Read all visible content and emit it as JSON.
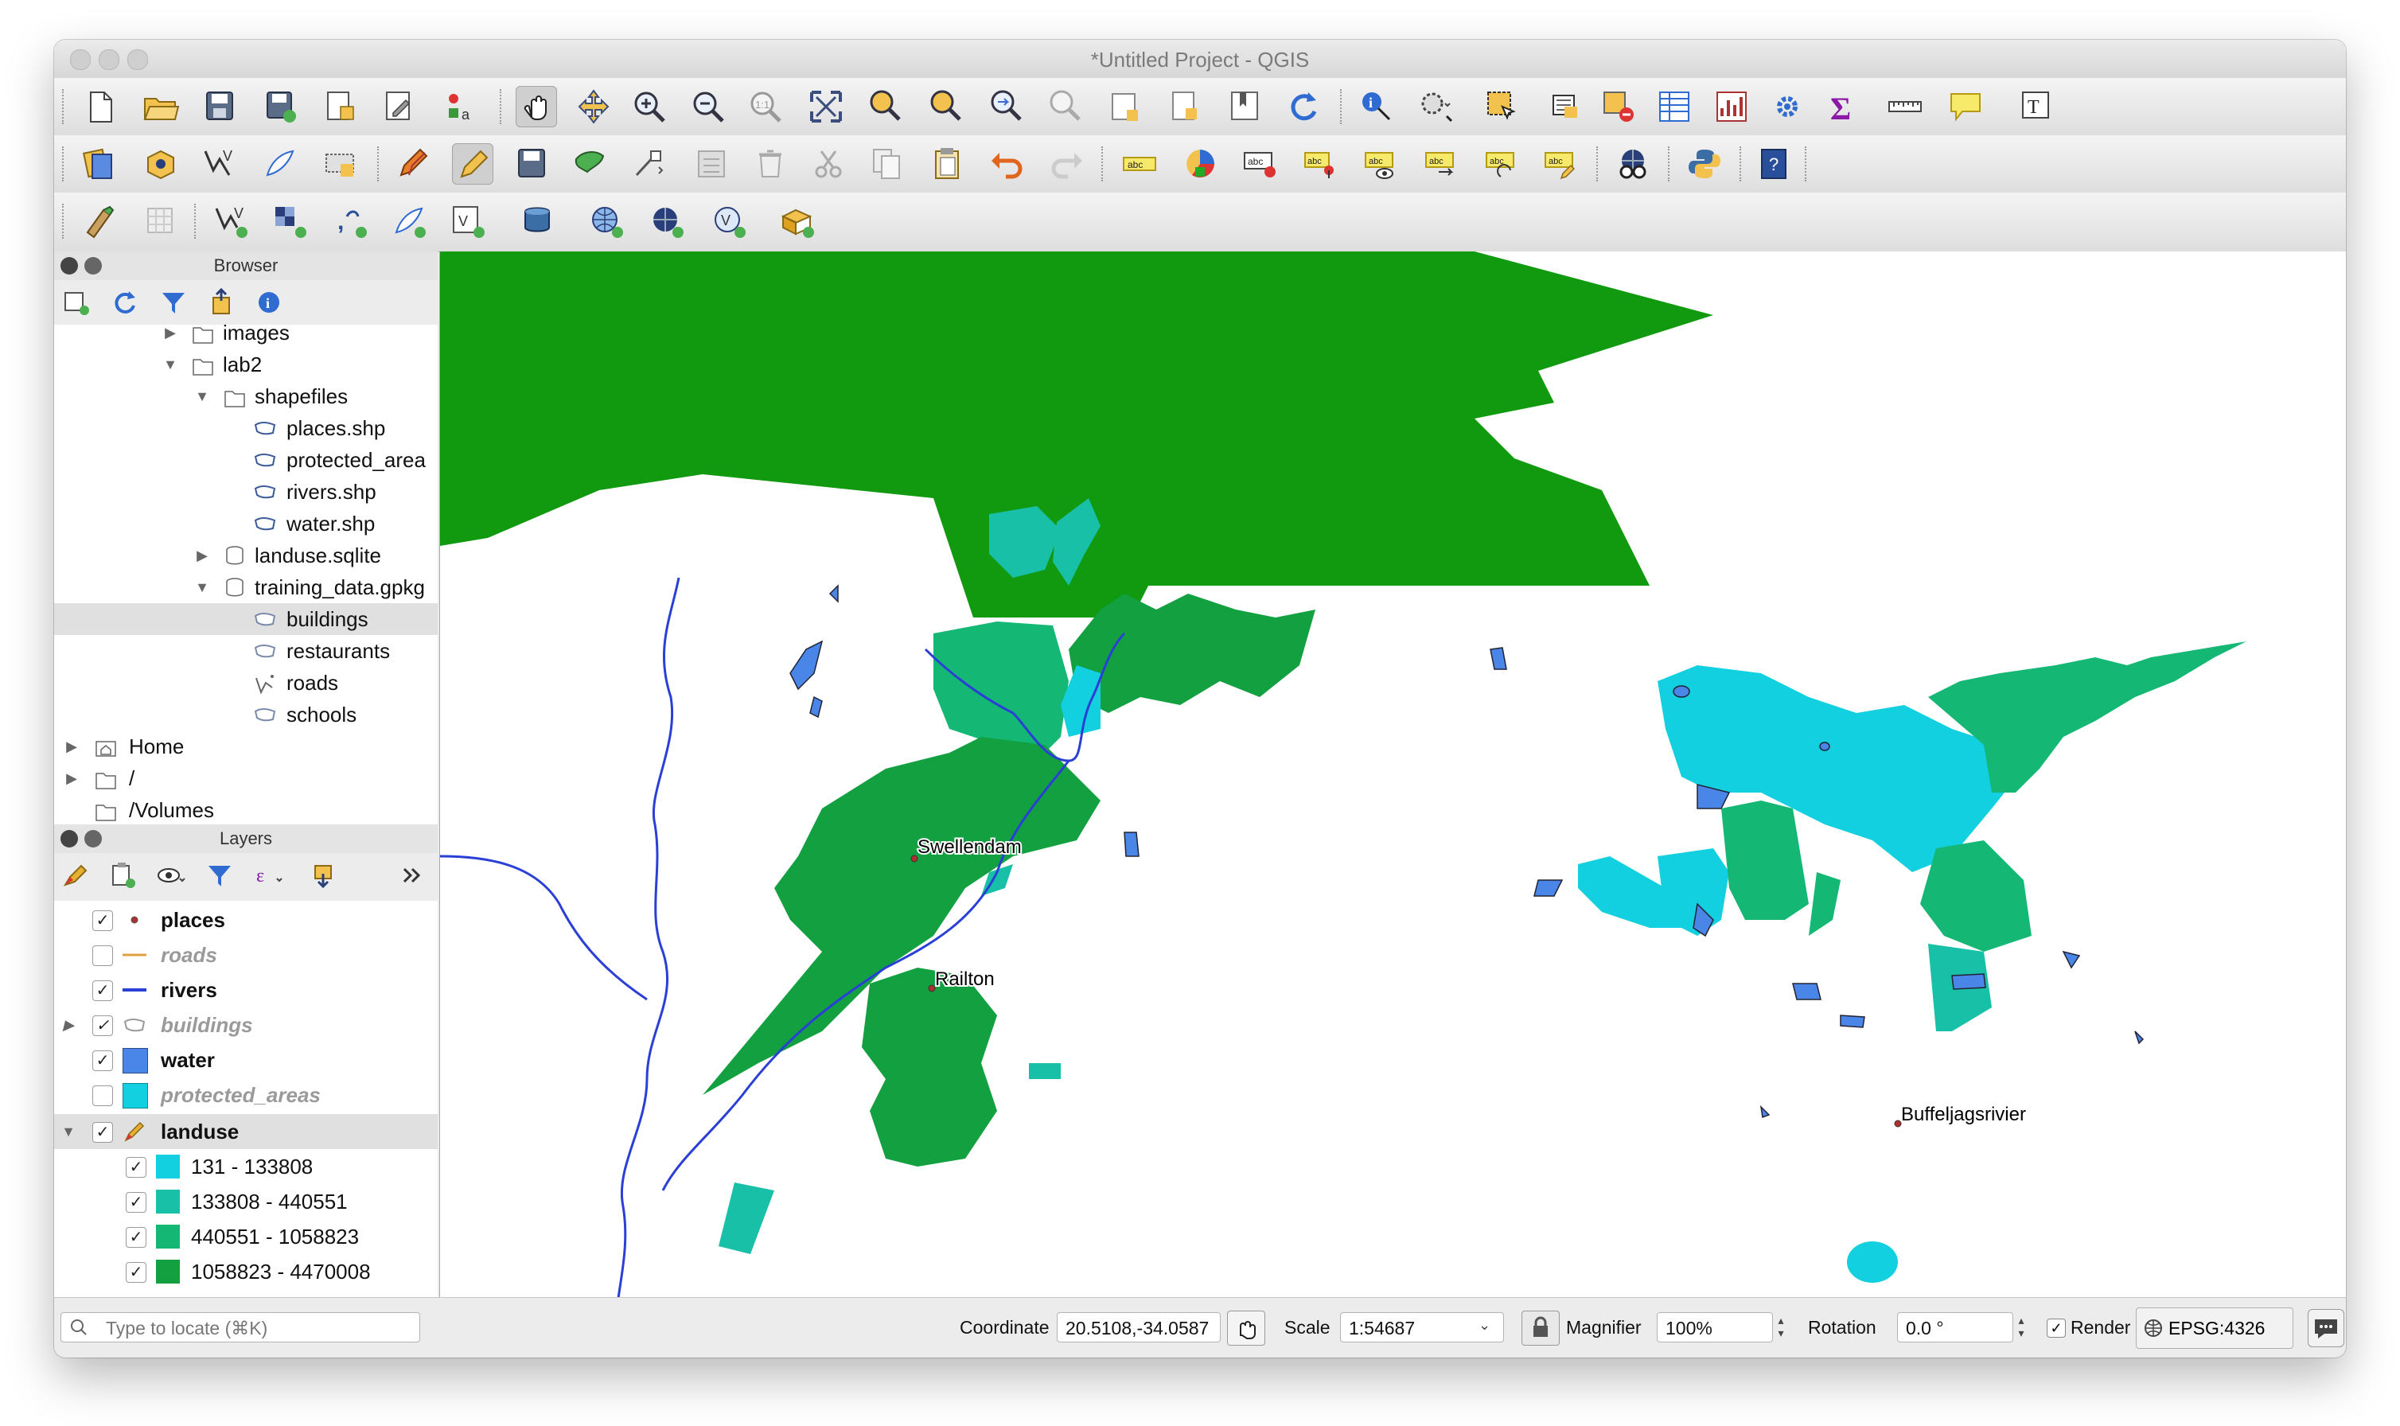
{
  "window": {
    "title": "*Untitled Project - QGIS"
  },
  "browser_panel": {
    "title": "Browser",
    "items": [
      {
        "label": "images"
      },
      {
        "label": "lab2"
      },
      {
        "label": "shapefiles"
      },
      {
        "label": "places.shp"
      },
      {
        "label": "protected_area"
      },
      {
        "label": "rivers.shp"
      },
      {
        "label": "water.shp"
      },
      {
        "label": "landuse.sqlite"
      },
      {
        "label": "training_data.gpkg"
      },
      {
        "label": "buildings"
      },
      {
        "label": "restaurants"
      },
      {
        "label": "roads"
      },
      {
        "label": "schools"
      },
      {
        "label": "Home"
      },
      {
        "label": "/"
      },
      {
        "label": "/Volumes"
      }
    ]
  },
  "layers_panel": {
    "title": "Layers",
    "layers": [
      {
        "label": "places",
        "checked": "✓"
      },
      {
        "label": "roads",
        "checked": ""
      },
      {
        "label": "rivers",
        "checked": "✓"
      },
      {
        "label": "buildings",
        "checked": "✓"
      },
      {
        "label": "water",
        "checked": "✓"
      },
      {
        "label": "protected_areas",
        "checked": ""
      },
      {
        "label": "landuse",
        "checked": "✓"
      }
    ],
    "landuse_classes": [
      {
        "label": "131 - 133808",
        "checked": "✓",
        "color": "#12d0e0"
      },
      {
        "label": "133808 - 440551",
        "checked": "✓",
        "color": "#18c0a8"
      },
      {
        "label": "440551 - 1058823",
        "checked": "✓",
        "color": "#14b874"
      },
      {
        "label": "1058823 - 4470008",
        "checked": "✓",
        "color": "#12a040"
      }
    ]
  },
  "map": {
    "labels": [
      {
        "text": "Swellendam"
      },
      {
        "text": "Railton"
      },
      {
        "text": "Buffeljagsrivier"
      }
    ],
    "colors": {
      "green_dark": "#11990f",
      "landuse_4": "#12a040",
      "landuse_3": "#14b874",
      "landuse_2": "#18c0a8",
      "landuse_1": "#12d0e0",
      "water": "#4a86e8",
      "river": "#2a3fd6"
    }
  },
  "statusbar": {
    "locate_placeholder": "Type to locate (⌘K)",
    "coordinate_label": "Coordinate",
    "coordinate_value": "20.5108,-34.0587",
    "scale_label": "Scale",
    "scale_value": "1:54687",
    "magnifier_label": "Magnifier",
    "magnifier_value": "100%",
    "rotation_label": "Rotation",
    "rotation_value": "0.0 °",
    "render_label": "Render",
    "crs_label": "EPSG:4326"
  }
}
